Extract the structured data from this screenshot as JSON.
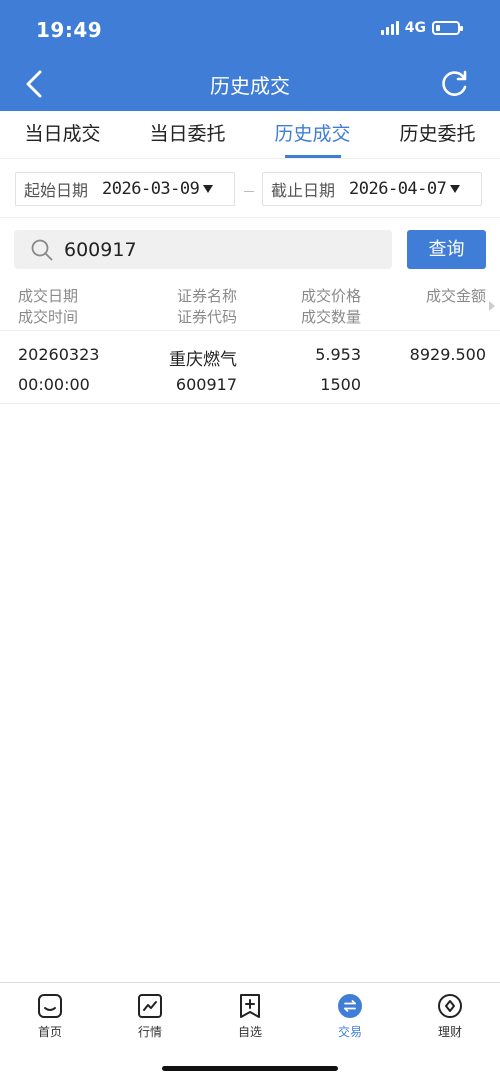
{
  "status_bar": {
    "time": "19:49",
    "network": "4G",
    "battery_level": 0.15
  },
  "header": {
    "title": "历史成交"
  },
  "tabs": [
    {
      "label": "当日成交",
      "active": false
    },
    {
      "label": "当日委托",
      "active": false
    },
    {
      "label": "历史成交",
      "active": true
    },
    {
      "label": "历史委托",
      "active": false
    }
  ],
  "date_filter": {
    "start_label": "起始日期",
    "start_value": "2026-03-09",
    "end_label": "截止日期",
    "end_value": "2026-04-07"
  },
  "search": {
    "value": "600917",
    "button_label": "查询"
  },
  "table": {
    "headers": {
      "col1_line1": "成交日期",
      "col1_line2": "成交时间",
      "col2_line1": "证券名称",
      "col2_line2": "证券代码",
      "col3_line1": "成交价格",
      "col3_line2": "成交数量",
      "col4_line1": "成交金额"
    },
    "rows": [
      {
        "date": "20260323",
        "time": "00:00:00",
        "name": "重庆燃气",
        "code": "600917",
        "price": "5.953",
        "quantity": "1500",
        "amount": "8929.500"
      }
    ]
  },
  "bottom_nav": [
    {
      "label": "首页",
      "icon": "home-icon",
      "active": false
    },
    {
      "label": "行情",
      "icon": "market-chart-icon",
      "active": false
    },
    {
      "label": "自选",
      "icon": "watchlist-add-icon",
      "active": false
    },
    {
      "label": "交易",
      "icon": "trade-exchange-icon",
      "active": true
    },
    {
      "label": "理财",
      "icon": "wealth-icon",
      "active": false
    }
  ],
  "colors": {
    "primary": "#3f7dd7",
    "header_text": "#ffffff",
    "muted": "#8a8a8a"
  }
}
